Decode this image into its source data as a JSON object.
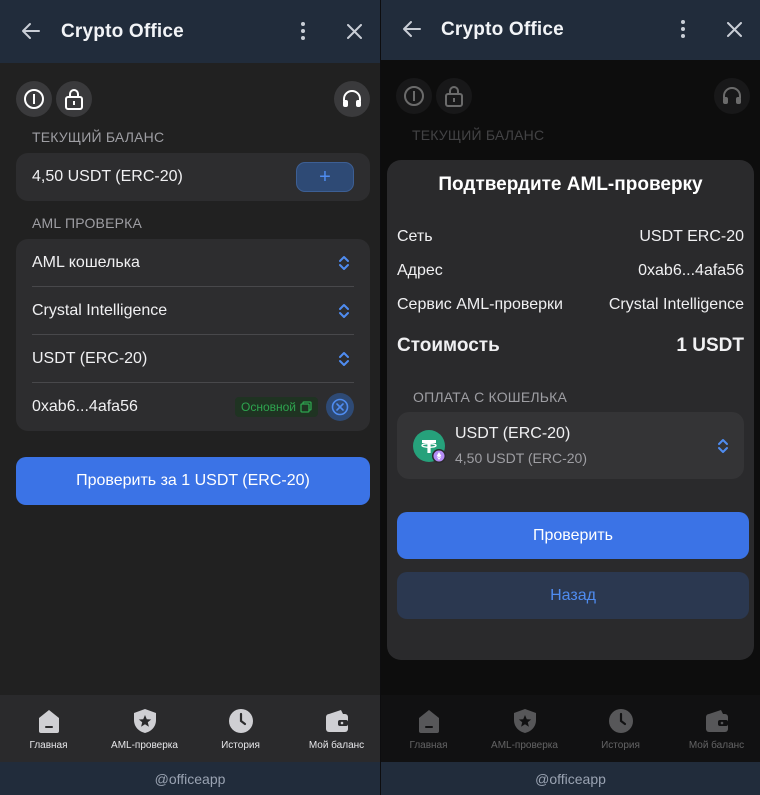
{
  "app": {
    "title": "Crypto Office"
  },
  "balance": {
    "label": "ТЕКУЩИЙ БАЛАНС",
    "value": "4,50 USDT (ERC-20)",
    "add_label": "+"
  },
  "aml": {
    "label": "AML ПРОВЕРКА",
    "fields": [
      "AML кошелька",
      "Crystal Intelligence",
      "USDT (ERC-20)"
    ],
    "address": "0xab6...4afa56",
    "badge": "Основной",
    "check_button": "Проверить за 1 USDT (ERC-20)"
  },
  "nav": {
    "items": [
      {
        "label": "Главная",
        "icon": "home-icon"
      },
      {
        "label": "AML-проверка",
        "icon": "shield-star-icon"
      },
      {
        "label": "История",
        "icon": "clock-icon"
      },
      {
        "label": "Мой баланс",
        "icon": "wallet-icon"
      }
    ]
  },
  "footer": {
    "text": "@officeapp"
  },
  "modal": {
    "title": "Подтвердите AML-проверку",
    "rows": [
      {
        "key": "Сеть",
        "value": "USDT ERC-20"
      },
      {
        "key": "Адрес",
        "value": "0xab6...4afa56"
      },
      {
        "key": "Сервис AML-проверки",
        "value": "Crystal Intelligence"
      }
    ],
    "cost": {
      "key": "Стоимость",
      "value": "1 USDT"
    },
    "payment_label": "ОПЛАТА С КОШЕЛЬКА",
    "wallet": {
      "name": "USDT (ERC-20)",
      "balance": "4,50 USDT (ERC-20)"
    },
    "confirm_button": "Проверить",
    "back_button": "Назад"
  },
  "colors": {
    "accent": "#3b73e6",
    "header": "#212c3b",
    "success": "#2ea44f",
    "tether": "#26a17b"
  }
}
